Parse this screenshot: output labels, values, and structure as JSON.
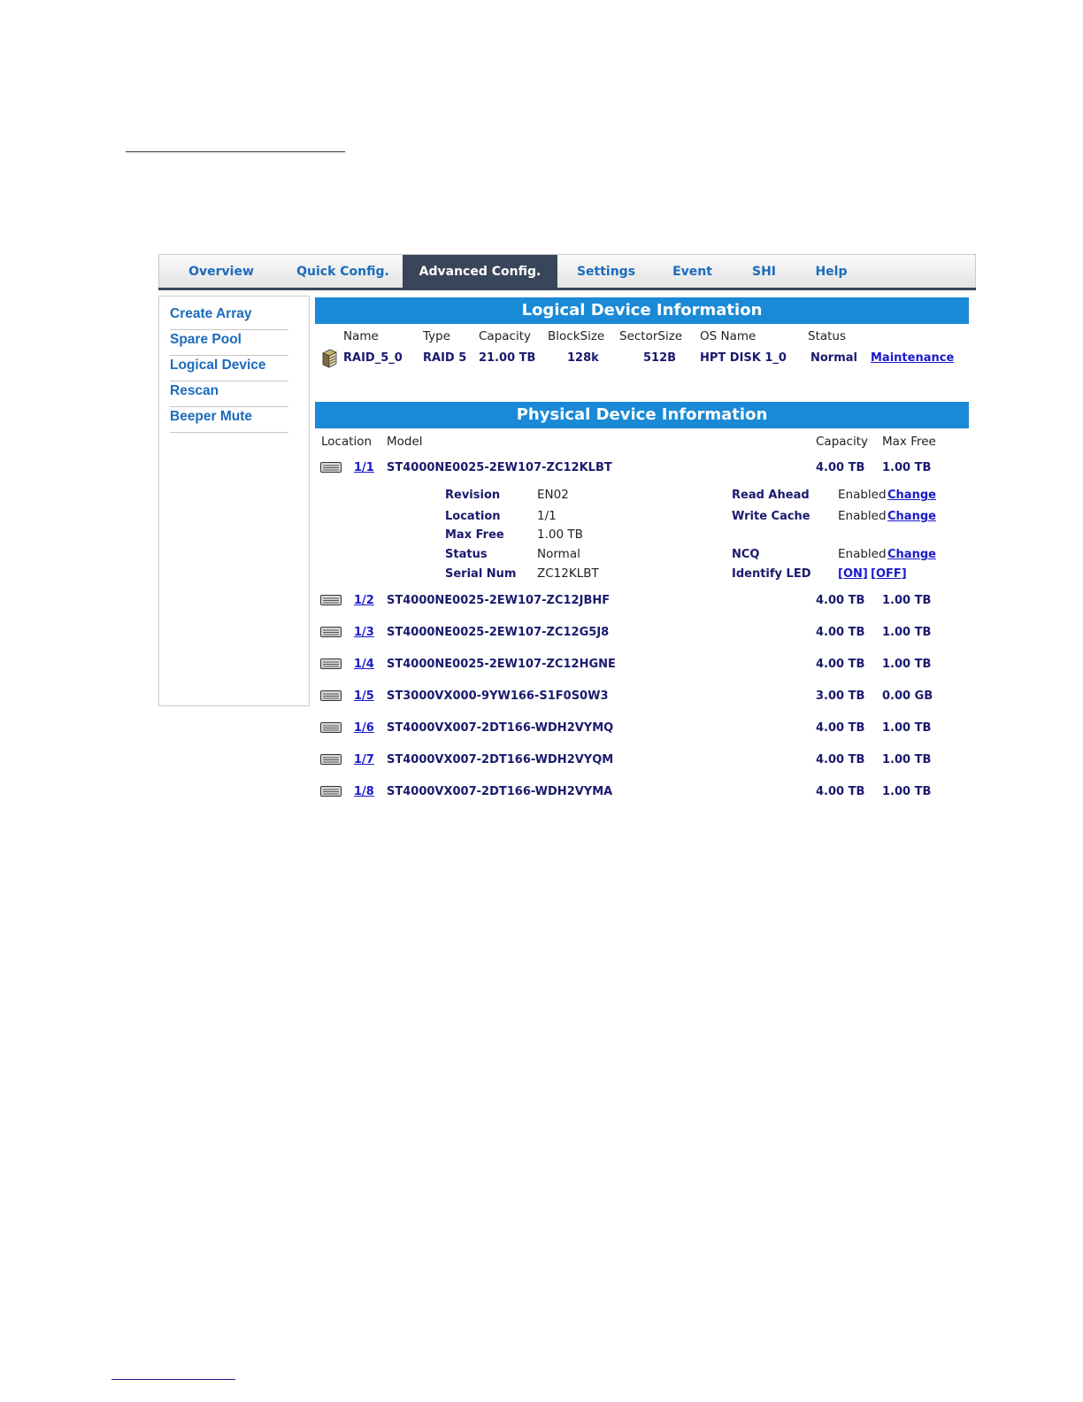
{
  "tabs": [
    {
      "label": "Overview",
      "active": false
    },
    {
      "label": "Quick Config.",
      "active": false
    },
    {
      "label": "Advanced Config.",
      "active": true
    },
    {
      "label": "Settings",
      "active": false
    },
    {
      "label": "Event",
      "active": false
    },
    {
      "label": "SHI",
      "active": false
    },
    {
      "label": "Help",
      "active": false
    }
  ],
  "sidebar": {
    "items": [
      "Create Array",
      "Spare Pool",
      "Logical Device",
      "Rescan",
      "Beeper Mute"
    ]
  },
  "logical": {
    "title": "Logical Device Information",
    "headers": {
      "name": "Name",
      "type": "Type",
      "capacity": "Capacity",
      "blocksize": "BlockSize",
      "sectorsize": "SectorSize",
      "osname": "OS Name",
      "status": "Status"
    },
    "row": {
      "name": "RAID_5_0",
      "type": "RAID 5",
      "capacity": "21.00 TB",
      "blocksize": "128k",
      "sectorsize": "512B",
      "osname": "HPT DISK 1_0",
      "status": "Normal",
      "action": "Maintenance"
    }
  },
  "physical": {
    "title": "Physical Device Information",
    "headers": {
      "location": "Location",
      "model": "Model",
      "capacity": "Capacity",
      "maxfree": "Max Free"
    },
    "devices": [
      {
        "location": "1/1",
        "model": "ST4000NE0025-2EW107-ZC12KLBT",
        "capacity": "4.00 TB",
        "maxfree": "1.00 TB"
      },
      {
        "location": "1/2",
        "model": "ST4000NE0025-2EW107-ZC12JBHF",
        "capacity": "4.00 TB",
        "maxfree": "1.00 TB"
      },
      {
        "location": "1/3",
        "model": "ST4000NE0025-2EW107-ZC12G5J8",
        "capacity": "4.00 TB",
        "maxfree": "1.00 TB"
      },
      {
        "location": "1/4",
        "model": "ST4000NE0025-2EW107-ZC12HGNE",
        "capacity": "4.00 TB",
        "maxfree": "1.00 TB"
      },
      {
        "location": "1/5",
        "model": "ST3000VX000-9YW166-S1F0S0W3",
        "capacity": "3.00 TB",
        "maxfree": "0.00 GB"
      },
      {
        "location": "1/6",
        "model": "ST4000VX007-2DT166-WDH2VYMQ",
        "capacity": "4.00 TB",
        "maxfree": "1.00 TB"
      },
      {
        "location": "1/7",
        "model": "ST4000VX007-2DT166-WDH2VYQM",
        "capacity": "4.00 TB",
        "maxfree": "1.00 TB"
      },
      {
        "location": "1/8",
        "model": "ST4000VX007-2DT166-WDH2VYMA",
        "capacity": "4.00 TB",
        "maxfree": "1.00 TB"
      }
    ],
    "details": {
      "revision_label": "Revision",
      "revision": "EN02",
      "location_label": "Location",
      "location": "1/1",
      "maxfree_label": "Max Free",
      "maxfree": "1.00 TB",
      "status_label": "Status",
      "status": "Normal",
      "serial_label": "Serial Num",
      "serial": "ZC12KLBT",
      "readahead_label": "Read Ahead",
      "readahead": "Enabled",
      "writecache_label": "Write Cache",
      "writecache": "Enabled",
      "ncq_label": "NCQ",
      "ncq": "Enabled",
      "identify_label": "Identify LED",
      "led_on": "[ON]",
      "led_off": "[OFF]",
      "change_label": "Change"
    }
  }
}
